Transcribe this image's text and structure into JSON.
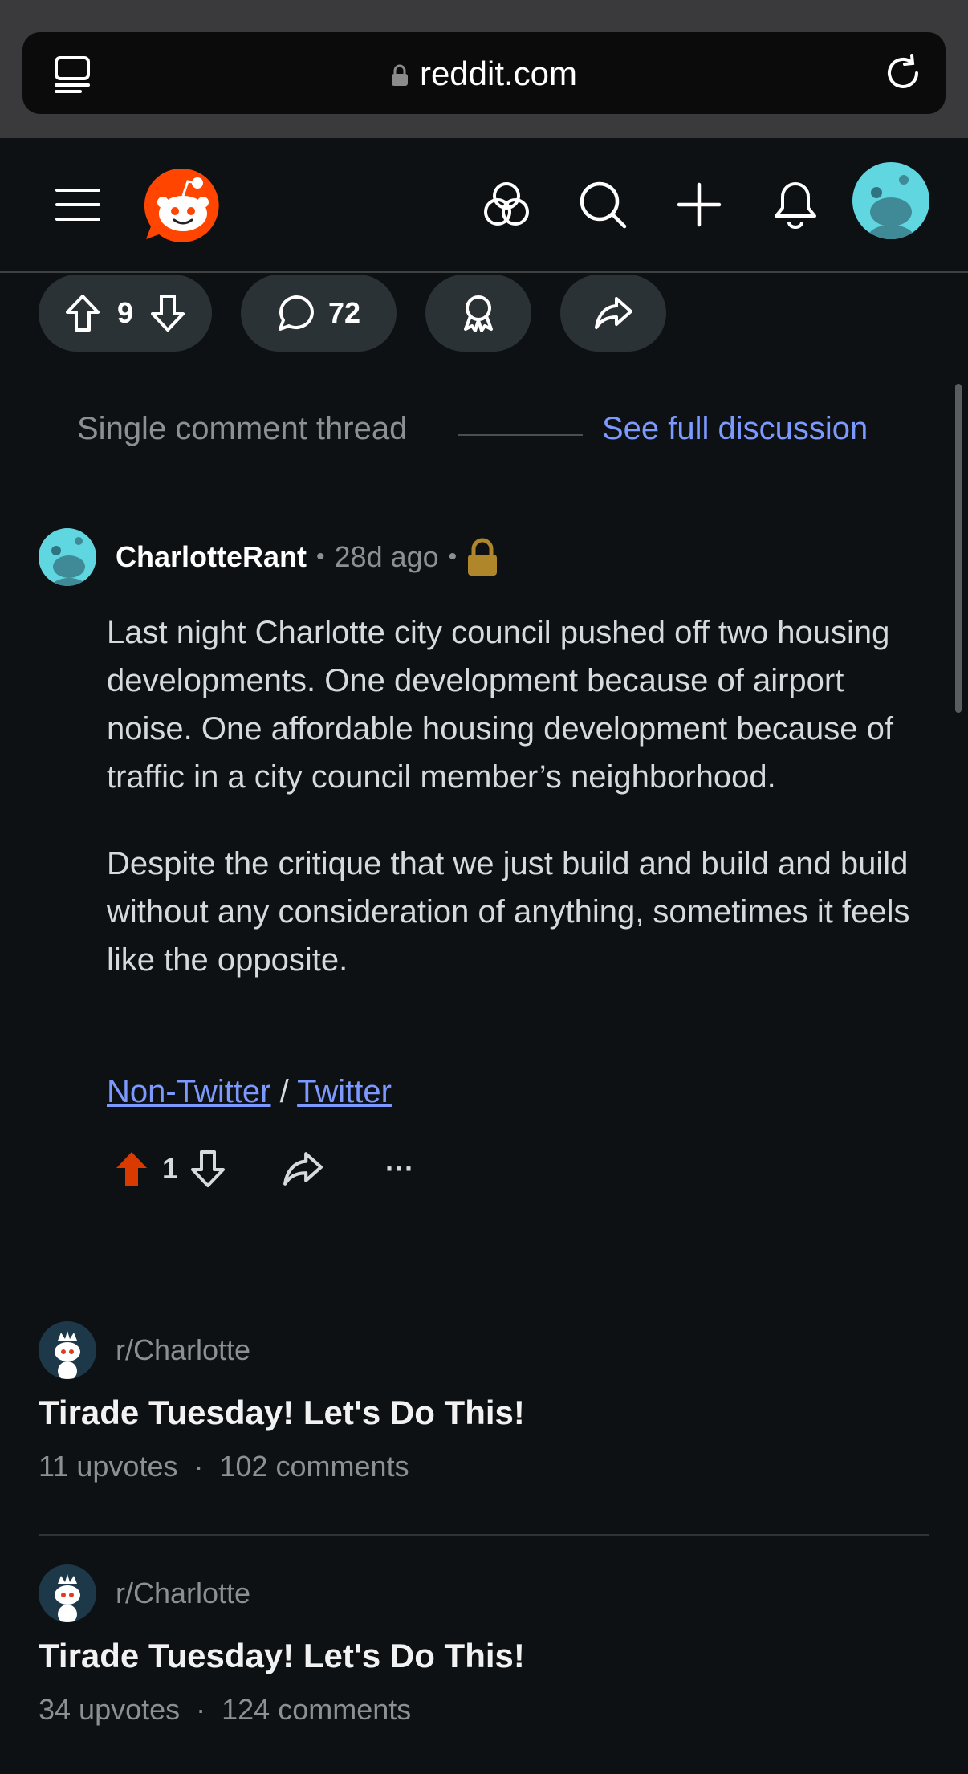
{
  "browser": {
    "url": "reddit.com"
  },
  "post_actions": {
    "score": "9",
    "comments": "72"
  },
  "thread": {
    "label": "Single comment thread",
    "see_full": "See full discussion"
  },
  "comment": {
    "username": "CharlotteRant",
    "time": "28d ago",
    "paragraphs": [
      "Last night Charlotte city council pushed off two housing developments. One development because of airport noise. One affordable housing development because of traffic in a city council member’s neighborhood.",
      "Despite the critique that we just build and build and build without any consideration of anything, sometimes it feels like the opposite."
    ],
    "link1": "Non-Twitter",
    "link_sep": "/",
    "link2": "Twitter",
    "score": "1",
    "upvoted": true,
    "more": "···"
  },
  "related": [
    {
      "subreddit": "r/Charlotte",
      "title": "Tirade Tuesday! Let's Do This!",
      "upvotes": "11 upvotes",
      "comments": "102 comments"
    },
    {
      "subreddit": "r/Charlotte",
      "title": "Tirade Tuesday! Let's Do This!",
      "upvotes": "34 upvotes",
      "comments": "124 comments"
    }
  ],
  "colors": {
    "accent_link": "#7c99ff",
    "upvote": "#d93a00",
    "brand": "#ff4500",
    "lock": "#b0862a"
  }
}
